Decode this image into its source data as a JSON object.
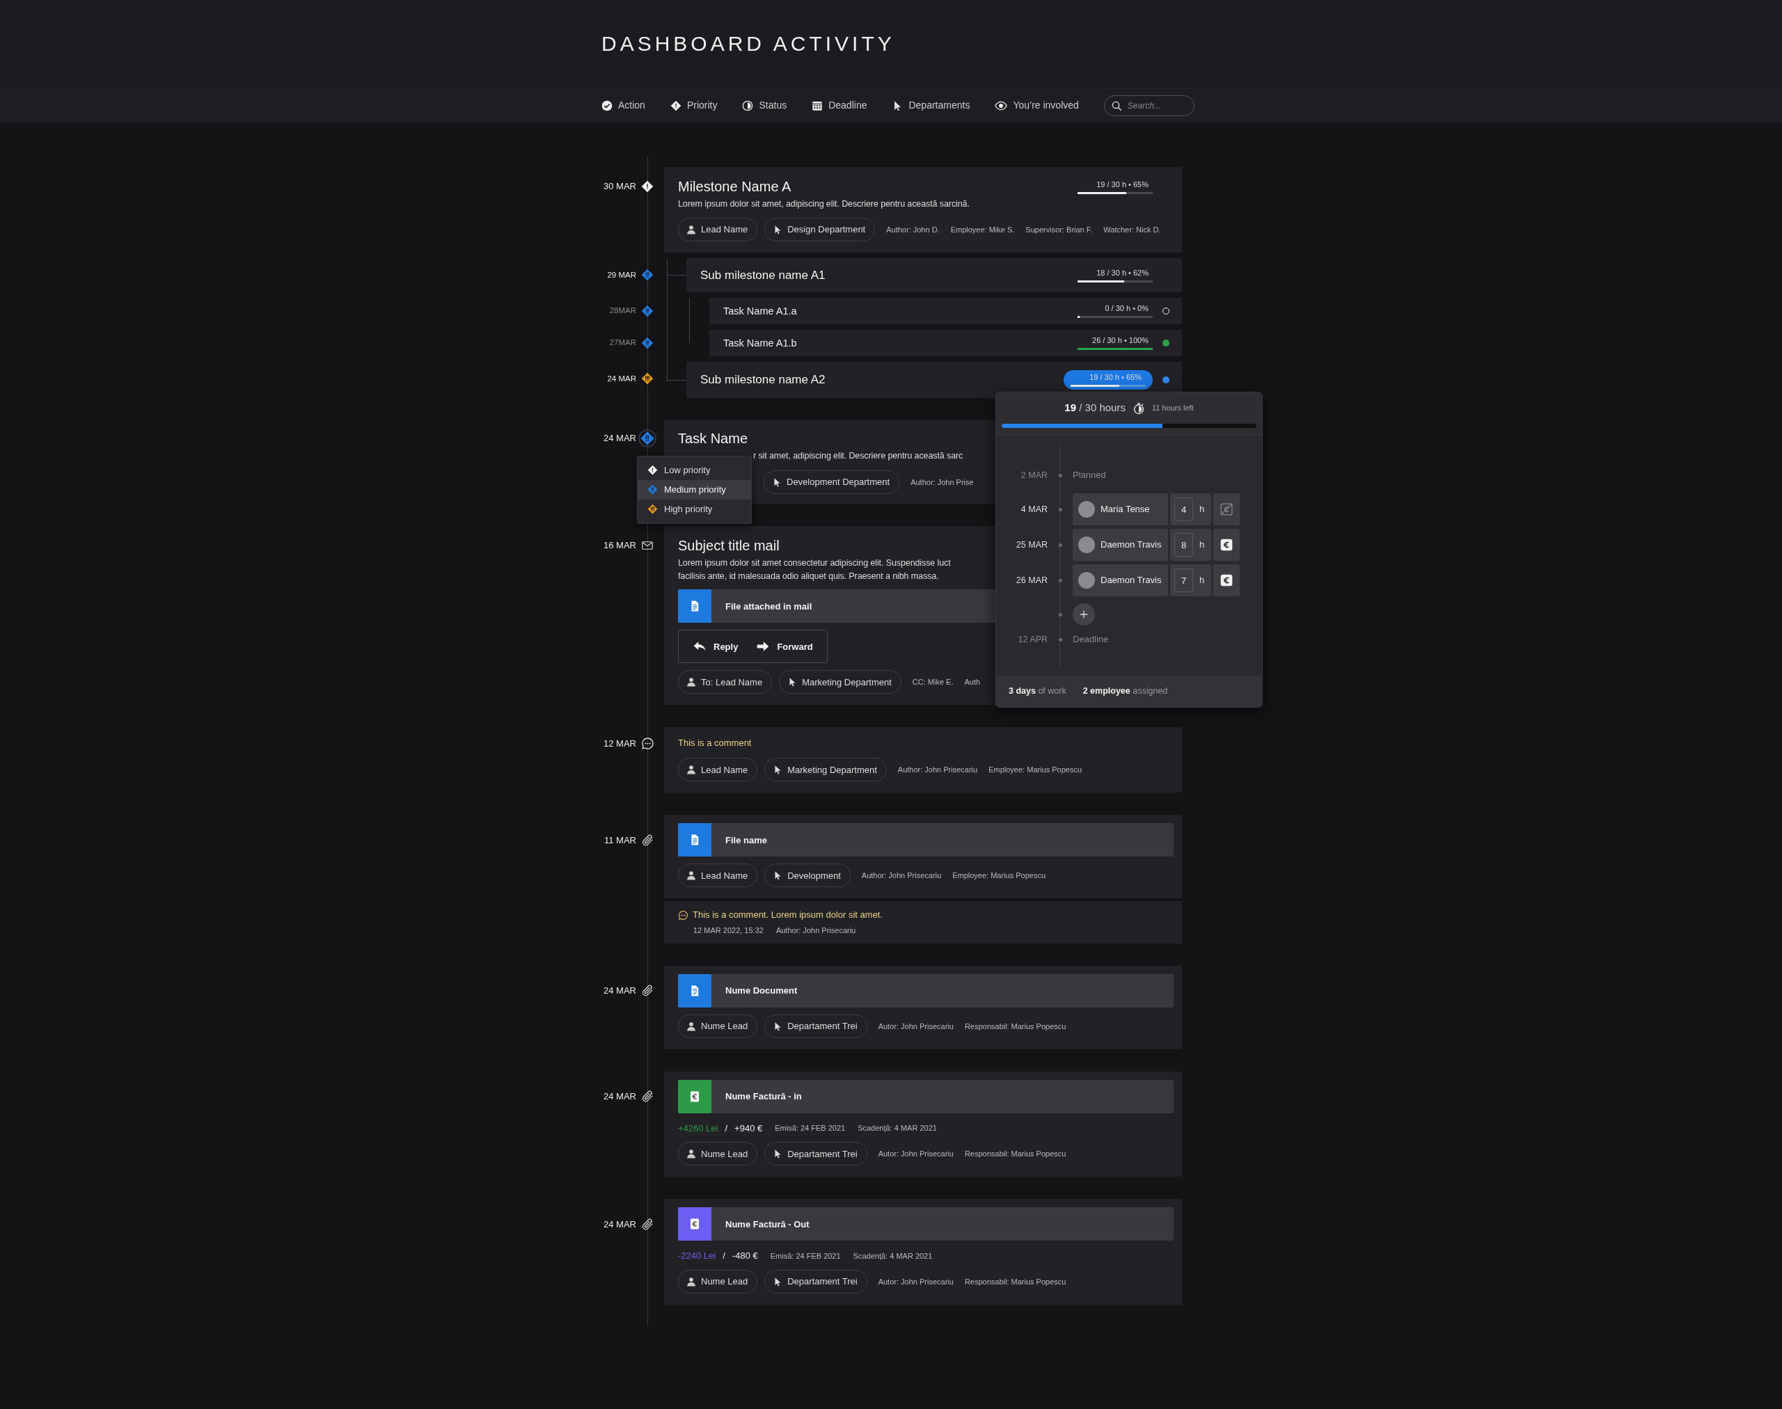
{
  "title": "DASHBOARD ACTIVITY",
  "filters": [
    {
      "kind": "action",
      "label": "Action"
    },
    {
      "kind": "priority",
      "label": "Priority"
    },
    {
      "kind": "status",
      "label": "Status"
    },
    {
      "kind": "deadline",
      "label": "Deadline"
    },
    {
      "kind": "departments",
      "label": "Departaments"
    },
    {
      "kind": "involved",
      "label": "You’re involved"
    }
  ],
  "search": {
    "placeholder": "Search..."
  },
  "timeline": [
    {
      "kind": "milestone",
      "date": "30 MAR",
      "priority": {
        "kind": "low",
        "color": "#f2f2f2"
      },
      "title": "Milestone Name A",
      "description": "Lorem ipsum dolor sit amet, adipiscing elit. Descriere pentru această sarcină.",
      "progress": {
        "reading": "19 / 30 h • 65%",
        "level": 0.65
      },
      "selected": false,
      "chips": [
        {
          "kind": "person",
          "label": "Lead Name"
        },
        {
          "kind": "department",
          "label": "Design Department"
        }
      ],
      "meta": [
        "Author: John D.",
        "Employee: Mike S.",
        "Supervisor: Brian F.",
        "Watcher: Nick D."
      ],
      "children": [
        {
          "kind": "submilestone",
          "date": "29 MAR",
          "priority": {
            "kind": "medium",
            "color": "#1f7ae0"
          },
          "title": "Sub milestone name A1",
          "progress": {
            "reading": "18 / 30 h • 62%",
            "level": 0.62
          },
          "selected": false,
          "children": [
            {
              "kind": "task",
              "date": "28MAR",
              "priority": {
                "kind": "medium",
                "color": "#1f7ae0"
              },
              "title": "Task Name A1.a",
              "progress": {
                "reading": "0 / 30 h • 0%",
                "level": 0
              },
              "selected": false,
              "status": {
                "filled": false
              }
            },
            {
              "kind": "task",
              "date": "27MAR",
              "priority": {
                "kind": "medium",
                "color": "#1f7ae0"
              },
              "title": "Task Name A1.b",
              "progress": {
                "reading": "26 / 30 h • 100%",
                "level": 1
              },
              "selected": false,
              "status": {
                "color": "#2aa54a",
                "filled": true
              }
            }
          ]
        },
        {
          "kind": "submilestone",
          "date": "24 MAR",
          "priority": {
            "kind": "high",
            "color": "#e89a1a"
          },
          "title": "Sub milestone name A2",
          "progress": {
            "reading": "19 / 30 h • 65%",
            "level": 0.65
          },
          "selected": true,
          "status": {
            "color": "#2f86f0",
            "filled": true
          }
        }
      ]
    },
    {
      "kind": "task_card",
      "date": "24 MAR",
      "priority": {
        "kind": "medium",
        "color": "#1f7ae0"
      },
      "title": "Task Name",
      "description": "r sit amet, adipiscing elit. Descriere pentru această sarc",
      "chips": [
        {
          "kind": "department",
          "label": "Development Department"
        }
      ],
      "meta": [
        "Author: John Prise"
      ],
      "priority_menu": [
        {
          "priority": {
            "kind": "low",
            "color": "#f2f2f2"
          },
          "label": "Low priority",
          "selected": false
        },
        {
          "priority": {
            "kind": "medium",
            "color": "#1f7ae0"
          },
          "label": "Medium priority",
          "selected": true
        },
        {
          "priority": {
            "kind": "high",
            "color": "#e89a1a"
          },
          "label": "High priority",
          "selected": false
        }
      ]
    },
    {
      "kind": "mail",
      "date": "16 MAR",
      "title": "Subject title mail",
      "description_lines": [
        "Lorem ipsum dolor sit amet consectetur adipiscing elit. Suspendisse luct",
        "facilisis ante, id malesuada odio aliquet quis. Praesent a nibh massa."
      ],
      "file": {
        "kind": "doc",
        "name": "File attached in mail",
        "color": "#1f7ae0"
      },
      "actions": [
        {
          "kind": "reply",
          "label": "Reply"
        },
        {
          "kind": "forward",
          "label": "Forward"
        }
      ],
      "chips": [
        {
          "kind": "person",
          "label": "To: Lead Name"
        },
        {
          "kind": "department",
          "label": "Marketing Department"
        }
      ],
      "meta": [
        "CC: Mike E.",
        "Auth"
      ]
    },
    {
      "kind": "comment",
      "date": "12 MAR",
      "text": "This is a comment",
      "chips": [
        {
          "kind": "person",
          "label": "Lead Name"
        },
        {
          "kind": "department",
          "label": "Marketing Department"
        }
      ],
      "meta": [
        "Author: John Prisecariu",
        "Employee: Marius Popescu"
      ]
    },
    {
      "kind": "file",
      "date": "11 MAR",
      "file": {
        "kind": "doc",
        "name": "File name",
        "color": "#1f7ae0"
      },
      "chips": [
        {
          "kind": "person",
          "label": "Lead Name"
        },
        {
          "kind": "department",
          "label": "Development"
        }
      ],
      "meta": [
        "Author: John Prisecariu",
        "Employee: Marius Popescu"
      ],
      "comment": {
        "text": "This is a comment. Lorem ipsum dolor sit amet.",
        "date": "12 MAR 2022, 15:32",
        "author": "Author: John Prisecariu"
      }
    },
    {
      "kind": "file",
      "date": "24 MAR",
      "file": {
        "kind": "doc_check",
        "name": "Nume Document",
        "color": "#1f7ae0"
      },
      "chips": [
        {
          "kind": "person",
          "label": "Nume Lead"
        },
        {
          "kind": "department",
          "label": "Departament Trei"
        }
      ],
      "meta": [
        "Autor: John Prisecariu",
        "Responsabil: Marius Popescu"
      ]
    },
    {
      "kind": "invoice",
      "date": "24 MAR",
      "file": {
        "kind": "invoice",
        "name": "Nume Factură - in",
        "color": "#2e9a48"
      },
      "amounts": {
        "lei": "+4260 Lei",
        "separator": "/",
        "eur": "+940 €",
        "issued": "Emisă: 24 FEB 2021",
        "due": "Scadență: 4 MAR 2021"
      },
      "chips": [
        {
          "kind": "person",
          "label": "Nume Lead"
        },
        {
          "kind": "department",
          "label": "Departament Trei"
        }
      ],
      "meta": [
        "Autor: John Prisecariu",
        "Responsabil: Marius Popescu"
      ]
    },
    {
      "kind": "invoice",
      "date": "24 MAR",
      "file": {
        "kind": "invoice",
        "name": "Nume Factură - Out",
        "color": "#6a5ff0"
      },
      "amounts": {
        "lei": "-2240 Lei",
        "separator": "/",
        "eur": "-480 €",
        "issued": "Emisă: 24 FEB 2021",
        "due": "Scadență: 4 MAR 2021"
      },
      "chips": [
        {
          "kind": "person",
          "label": "Nume Lead"
        },
        {
          "kind": "department",
          "label": "Departament Trei"
        }
      ],
      "meta": [
        "Autor: John Prisecariu",
        "Responsabil: Marius Popescu"
      ]
    }
  ],
  "popup": {
    "hours": "**19** / 30 hours",
    "left": "11 hours left",
    "level": 0.63,
    "entries": [
      {
        "kind": "marker",
        "date": "2 MAR",
        "label": "Planned"
      },
      {
        "kind": "work",
        "date": "4 MAR",
        "name": "Maria Tense",
        "hours": "4",
        "unit": "h",
        "invoiced": false
      },
      {
        "kind": "work",
        "date": "25 MAR",
        "name": "Daemon Travis",
        "hours": "8",
        "unit": "h",
        "invoiced": true
      },
      {
        "kind": "work",
        "date": "26 MAR",
        "name": "Daemon Travis",
        "hours": "7",
        "unit": "h",
        "invoiced": true
      },
      {
        "kind": "add"
      },
      {
        "kind": "marker",
        "date": "12 APR",
        "label": "Deadline"
      }
    ],
    "footer": [
      "**3 days** of work",
      "**2 employee** assigned"
    ]
  }
}
